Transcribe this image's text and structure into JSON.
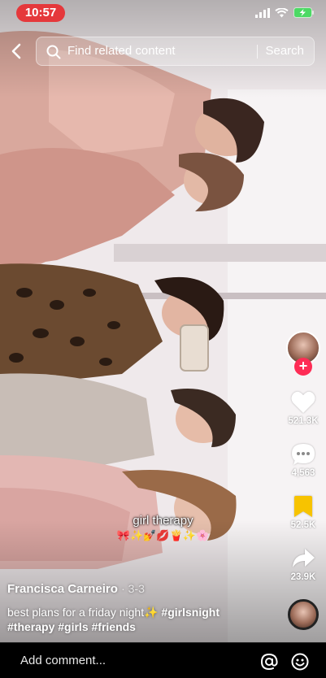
{
  "status_bar": {
    "time": "10:57"
  },
  "search": {
    "placeholder": "Find related content",
    "button_label": "Search"
  },
  "video": {
    "caption_sticker": "girl therapy",
    "caption_emojis": "🎀✨💅💋🍟✨🌸"
  },
  "actions": {
    "likes": "521.3K",
    "comments": "4,563",
    "saves": "52.5K",
    "shares": "23.9K"
  },
  "post": {
    "author": "Francisca Carneiro",
    "date": "3-3",
    "description": "best plans for a friday night✨",
    "hashtags": [
      "#girlsnight",
      "#therapy",
      "#girls",
      "#friends"
    ]
  },
  "comment_bar": {
    "placeholder": "Add comment..."
  },
  "colors": {
    "accent": "#fe2c55",
    "save": "#f7c300",
    "time_pill": "#e5383b"
  }
}
